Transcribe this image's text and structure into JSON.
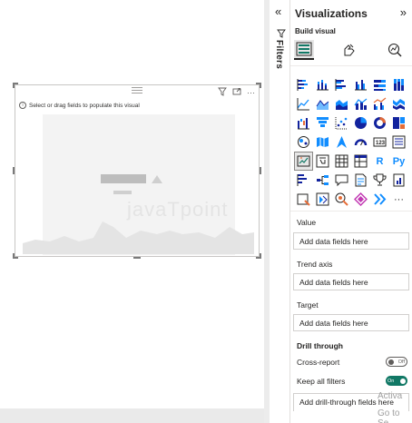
{
  "canvas": {
    "hint": "Select or drag fields to populate this visual",
    "watermark": "javaTpoint"
  },
  "filters": {
    "label": "Filters"
  },
  "pane": {
    "title": "Visualizations",
    "build_label": "Build visual",
    "more_label": "···"
  },
  "wells": {
    "value": {
      "label": "Value",
      "placeholder": "Add data fields here"
    },
    "trend": {
      "label": "Trend axis",
      "placeholder": "Add data fields here"
    },
    "target": {
      "label": "Target",
      "placeholder": "Add data fields here"
    }
  },
  "drill": {
    "title": "Drill through",
    "cross_report": {
      "label": "Cross-report",
      "state": "Off"
    },
    "keep_filters": {
      "label": "Keep all filters",
      "state": "On"
    },
    "add_field": "Add drill-through fields here"
  },
  "activate": {
    "line1": "Activa",
    "line2": "Go to Se"
  },
  "colors": {
    "accent": "#117865",
    "chart_blue": "#118dff",
    "chart_dark": "#12239e",
    "chart_orange": "#e66c37"
  },
  "icons": [
    "stacked-bar-icon",
    "stacked-column-icon",
    "clustered-bar-icon",
    "clustered-column-icon",
    "100-stacked-bar-icon",
    "100-stacked-column-icon",
    "line-chart-icon",
    "area-chart-icon",
    "stacked-area-icon",
    "line-stacked-column-icon",
    "line-clustered-column-icon",
    "ribbon-chart-icon",
    "waterfall-icon",
    "funnel-icon",
    "scatter-icon",
    "pie-icon",
    "donut-icon",
    "treemap-icon",
    "map-icon",
    "filled-map-icon",
    "azure-map-icon",
    "gauge-icon",
    "card-icon",
    "multi-row-card-icon",
    "kpi-icon",
    "slicer-icon",
    "table-icon",
    "matrix-icon",
    "r-visual-icon",
    "python-visual-icon",
    "key-influencers-icon",
    "decomposition-tree-icon",
    "qa-icon",
    "smart-narrative-icon",
    "trophy-icon",
    "paginated-report-icon",
    "power-apps-icon",
    "power-automate-icon",
    "arcgis-icon",
    "diamond-icon",
    "chevrons-icon",
    "more-icon"
  ]
}
